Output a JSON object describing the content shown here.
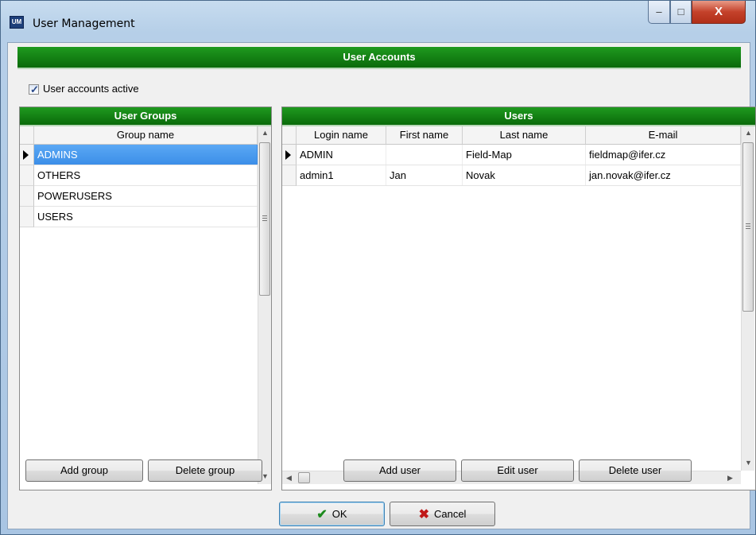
{
  "window": {
    "title": "User Management",
    "app_icon": "user-management-app-icon",
    "controls": {
      "minimize": "–",
      "maximize": "□",
      "close": "X"
    }
  },
  "header": {
    "title": "User Accounts"
  },
  "accounts_active": {
    "label": "User accounts active",
    "checked": true
  },
  "groups": {
    "title": "User Groups",
    "column": "Group name",
    "rows": [
      "ADMINS",
      "OTHERS",
      "POWERUSERS",
      "USERS"
    ],
    "selected_index": 0,
    "buttons": {
      "add": "Add group",
      "delete": "Delete group"
    }
  },
  "users": {
    "title": "Users",
    "columns": [
      "Login name",
      "First name",
      "Last name",
      "E-mail"
    ],
    "rows": [
      [
        "ADMIN",
        "",
        "Field-Map",
        "fieldmap@ifer.cz"
      ],
      [
        "admin1",
        "Jan",
        "Novak",
        "jan.novak@ifer.cz"
      ]
    ],
    "current_row_index": 0,
    "buttons": {
      "add": "Add user",
      "edit": "Edit user",
      "delete": "Delete user"
    }
  },
  "footer": {
    "ok": "OK",
    "cancel": "Cancel"
  },
  "colors": {
    "header_green": "#0a6a0a",
    "selection_blue": "#3c8ee8",
    "close_red": "#c4412a"
  }
}
